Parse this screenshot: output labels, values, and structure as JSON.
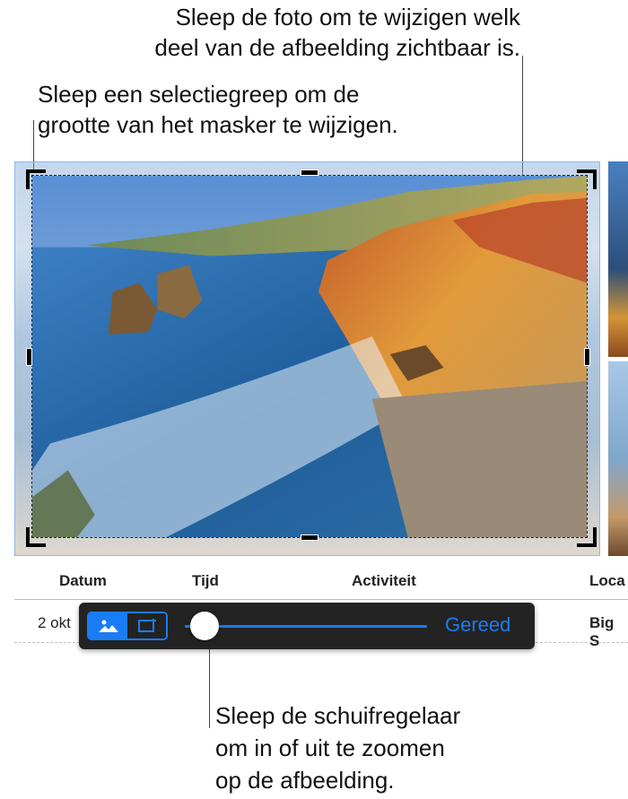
{
  "callouts": {
    "drag_photo": "Sleep de foto om te wijzigen welk\ndeel van de afbeelding zichtbaar is.",
    "drag_handle": "Sleep een selectiegreep om de\ngrootte van het masker te wijzigen.",
    "drag_slider": "Sleep de schuifregelaar\nom in of uit te zoomen\nop de afbeelding."
  },
  "table": {
    "headers": [
      "Datum",
      "Tijd",
      "Activiteit",
      "Loca"
    ],
    "row": [
      "2 okt",
      "Big S"
    ]
  },
  "toolbar": {
    "image_mode_icon": "photo-icon",
    "mask_mode_icon": "mask-crop-icon",
    "zoom_level": 0.08,
    "done_label": "Gereed",
    "accent": "#1a7cf5"
  }
}
